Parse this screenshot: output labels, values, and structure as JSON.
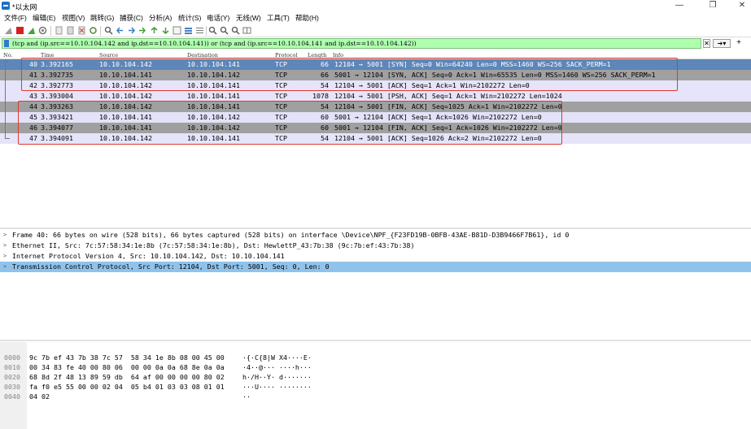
{
  "window": {
    "title": "*以太网"
  },
  "menu": [
    "文件(F)",
    "编辑(E)",
    "视图(V)",
    "跳转(G)",
    "捕获(C)",
    "分析(A)",
    "统计(S)",
    "电话(Y)",
    "无线(W)",
    "工具(T)",
    "帮助(H)"
  ],
  "filter": {
    "expression": "(tcp and (ip.src==10.10.104.142 and ip.dst==10.10.104.141)) or (tcp and (ip.src==10.10.104.141 and ip.dst==10.10.104.142))"
  },
  "columns": {
    "no": "No.",
    "time": "Time",
    "source": "Source",
    "destination": "Destination",
    "protocol": "Protocol",
    "length": "Length",
    "info": "Info"
  },
  "packets": [
    {
      "no": "40",
      "time": "3.392165",
      "src": "10.10.104.142",
      "dst": "10.10.104.141",
      "proto": "TCP",
      "len": "66",
      "info": "12104 → 5001 [SYN] Seq=0 Win=64240 Len=0 MSS=1460 WS=256 SACK_PERM=1"
    },
    {
      "no": "41",
      "time": "3.392735",
      "src": "10.10.104.141",
      "dst": "10.10.104.142",
      "proto": "TCP",
      "len": "66",
      "info": "5001 → 12104 [SYN, ACK] Seq=0 Ack=1 Win=65535 Len=0 MSS=1460 WS=256 SACK_PERM=1"
    },
    {
      "no": "42",
      "time": "3.392773",
      "src": "10.10.104.142",
      "dst": "10.10.104.141",
      "proto": "TCP",
      "len": "54",
      "info": "12104 → 5001 [ACK] Seq=1 Ack=1 Win=2102272 Len=0"
    },
    {
      "no": "43",
      "time": "3.393004",
      "src": "10.10.104.142",
      "dst": "10.10.104.141",
      "proto": "TCP",
      "len": "1078",
      "info": "12104 → 5001 [PSH, ACK] Seq=1 Ack=1 Win=2102272 Len=1024"
    },
    {
      "no": "44",
      "time": "3.393263",
      "src": "10.10.104.142",
      "dst": "10.10.104.141",
      "proto": "TCP",
      "len": "54",
      "info": "12104 → 5001 [FIN, ACK] Seq=1025 Ack=1 Win=2102272 Len=0"
    },
    {
      "no": "45",
      "time": "3.393421",
      "src": "10.10.104.141",
      "dst": "10.10.104.142",
      "proto": "TCP",
      "len": "60",
      "info": "5001 → 12104 [ACK] Seq=1 Ack=1026 Win=2102272 Len=0"
    },
    {
      "no": "46",
      "time": "3.394077",
      "src": "10.10.104.141",
      "dst": "10.10.104.142",
      "proto": "TCP",
      "len": "60",
      "info": "5001 → 12104 [FIN, ACK] Seq=1 Ack=1026 Win=2102272 Len=0"
    },
    {
      "no": "47",
      "time": "3.394091",
      "src": "10.10.104.142",
      "dst": "10.10.104.141",
      "proto": "TCP",
      "len": "54",
      "info": "12104 → 5001 [ACK] Seq=1026 Ack=2 Win=2102272 Len=0"
    }
  ],
  "details": [
    "Frame 40: 66 bytes on wire (528 bits), 66 bytes captured (528 bits) on interface \\Device\\NPF_{F23FD19B-0BFB-43AE-B81D-D3B9466F7B61}, id 0",
    "Ethernet II, Src: 7c:57:58:34:1e:8b (7c:57:58:34:1e:8b), Dst: HewlettP_43:7b:38 (9c:7b:ef:43:7b:38)",
    "Internet Protocol Version 4, Src: 10.10.104.142, Dst: 10.10.104.141",
    "Transmission Control Protocol, Src Port: 12104, Dst Port: 5001, Seq: 0, Len: 0"
  ],
  "hexdump": [
    {
      "offset": "0000",
      "bytes": "9c 7b ef 43 7b 38 7c 57  58 34 1e 8b 08 00 45 00",
      "ascii": "·{·C{8|W X4····E·"
    },
    {
      "offset": "0010",
      "bytes": "00 34 83 fe 40 00 80 06  00 00 0a 0a 68 8e 0a 0a",
      "ascii": "·4··@··· ····h···"
    },
    {
      "offset": "0020",
      "bytes": "68 8d 2f 48 13 89 59 db  64 af 00 00 00 00 80 02",
      "ascii": "h·/H··Y· d·······"
    },
    {
      "offset": "0030",
      "bytes": "fa f0 e5 55 00 00 02 04  05 b4 01 03 03 08 01 01",
      "ascii": "···U···· ········"
    },
    {
      "offset": "0040",
      "bytes": "04 02",
      "ascii": "··"
    }
  ]
}
